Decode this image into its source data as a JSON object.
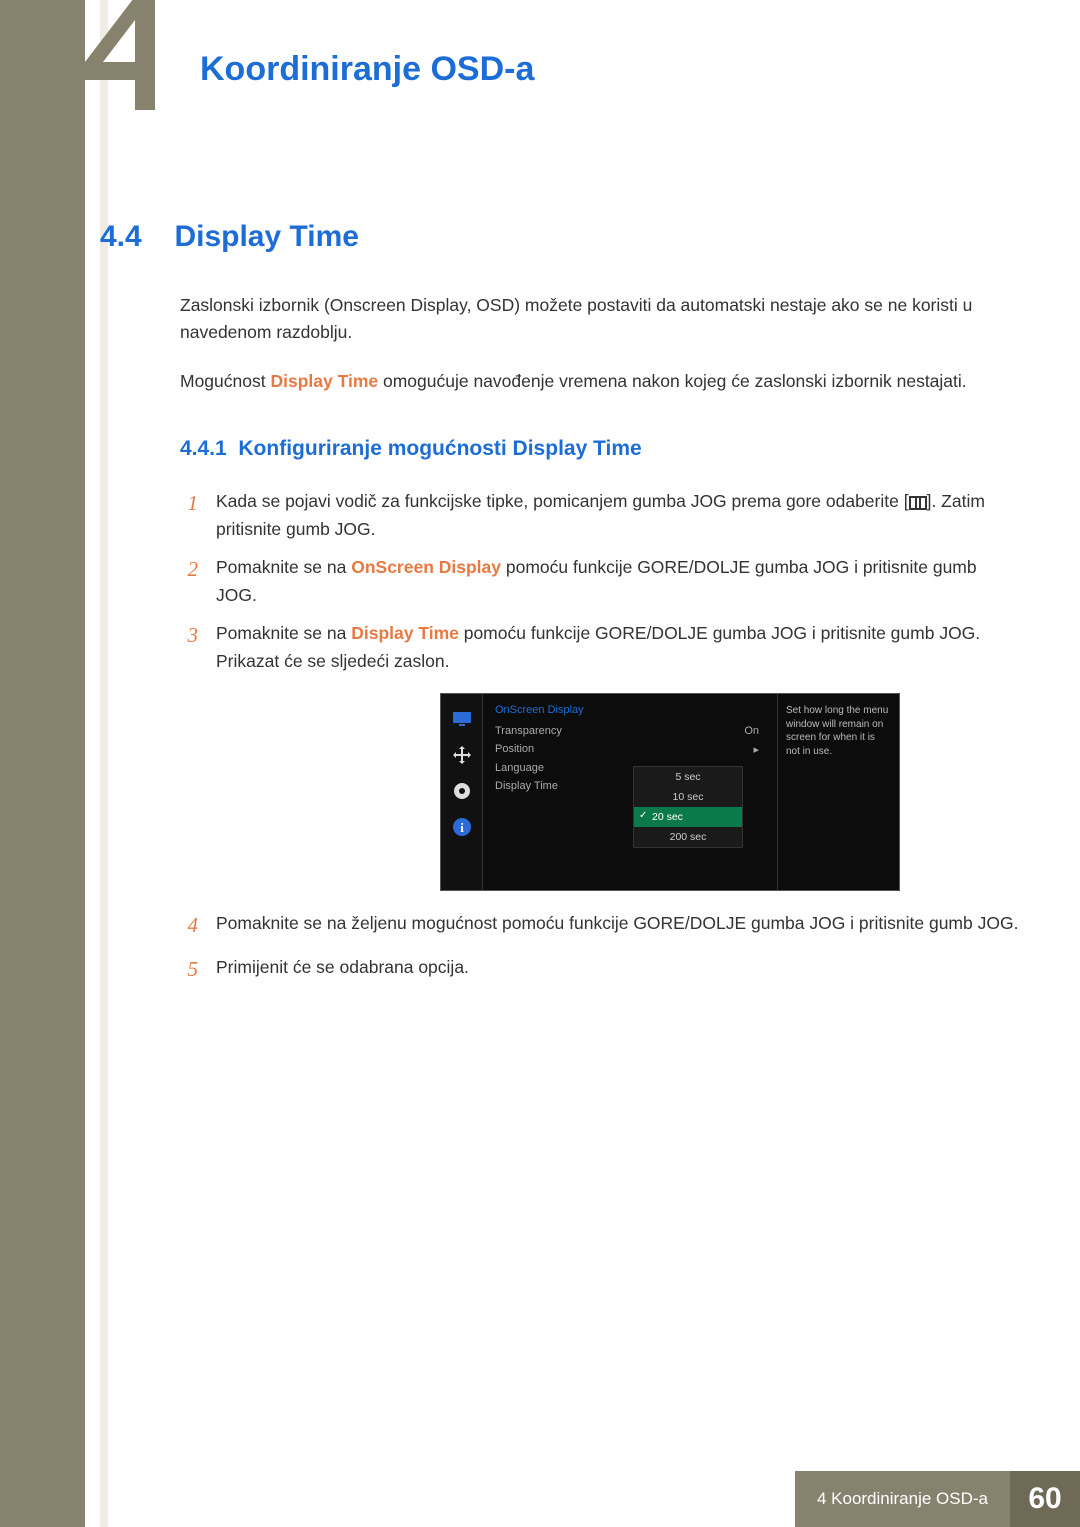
{
  "chapter": {
    "number_glyph": "4",
    "title": "Koordiniranje OSD-a"
  },
  "section": {
    "number": "4.4",
    "title": "Display Time",
    "intro1": "Zaslonski izbornik (Onscreen Display, OSD) možete postaviti da automatski nestaje ako se ne koristi u navedenom razdoblju.",
    "intro2_pre": "Mogućnost ",
    "intro2_em": "Display Time",
    "intro2_post": " omogućuje navođenje vremena nakon kojeg će zaslonski izbornik nestajati."
  },
  "subsection": {
    "number": "4.4.1",
    "title": "Konfiguriranje mogućnosti Display Time"
  },
  "steps": [
    {
      "n": "1",
      "pre": "Kada se pojavi vodič za funkcijske tipke, pomicanjem gumba JOG prema gore odaberite [",
      "icon": "menu",
      "post": "]. Zatim pritisnite gumb JOG."
    },
    {
      "n": "2",
      "pre": "Pomaknite se na ",
      "em": "OnScreen Display",
      "post": " pomoću funkcije GORE/DOLJE gumba JOG i pritisnite gumb JOG."
    },
    {
      "n": "3",
      "pre": "Pomaknite se na ",
      "em": "Display Time",
      "post": " pomoću funkcije GORE/DOLJE gumba JOG i pritisnite gumb JOG. Prikazat će se sljedeći zaslon."
    },
    {
      "n": "4",
      "text": "Pomaknite se na željenu mogućnost pomoću funkcije GORE/DOLJE gumba JOG i pritisnite gumb JOG."
    },
    {
      "n": "5",
      "text": "Primijenit će se odabrana opcija."
    }
  ],
  "osd": {
    "heading": "OnScreen Display",
    "rows": [
      {
        "label": "Transparency",
        "value": "On"
      },
      {
        "label": "Position",
        "value": "▸"
      },
      {
        "label": "Language",
        "value": ""
      },
      {
        "label": "Display Time",
        "value": ""
      }
    ],
    "submenu": [
      "5 sec",
      "10 sec",
      "20 sec",
      "200 sec"
    ],
    "submenu_selected_index": 2,
    "help": "Set how long the menu window will remain on screen for when it is not in use.",
    "icons": [
      "monitor",
      "move",
      "gear",
      "info"
    ]
  },
  "footer": {
    "label": "4 Koordiniranje OSD-a",
    "page": "60"
  }
}
